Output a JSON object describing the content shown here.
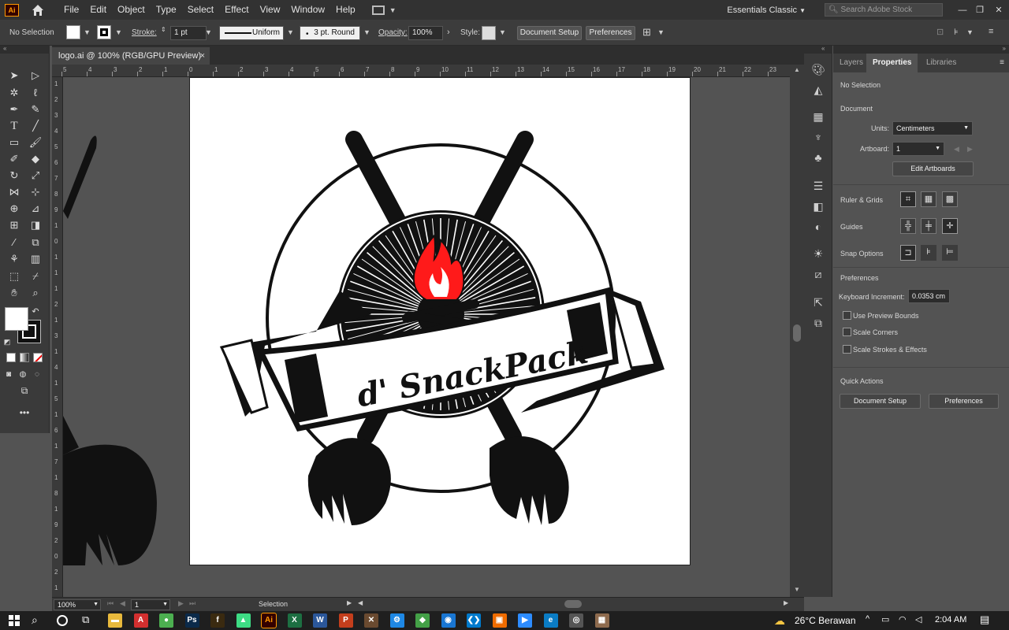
{
  "app": {
    "logo_text": "Ai",
    "brand_color": "#ff9a00",
    "menus": [
      "File",
      "Edit",
      "Object",
      "Type",
      "Select",
      "Effect",
      "View",
      "Window",
      "Help"
    ],
    "workspace": "Essentials Classic",
    "search_placeholder": "Search Adobe Stock"
  },
  "control_bar": {
    "selection": "No Selection",
    "stroke_label": "Stroke:",
    "stroke_weight": "1 pt",
    "profile": "Uniform",
    "brush": "3 pt. Round",
    "opacity_label": "Opacity:",
    "opacity": "100%",
    "style_label": "Style:",
    "doc_setup": "Document Setup",
    "preferences": "Preferences"
  },
  "document": {
    "tab_title": "logo.ai @ 100% (RGB/GPU Preview)",
    "close": "×",
    "logo_text": "d' SnackPack",
    "flame_color": "#ff1a1a"
  },
  "rulers": {
    "top": [
      "5",
      "4",
      "3",
      "2",
      "1",
      "0",
      "1",
      "2",
      "3",
      "4",
      "5",
      "6",
      "7",
      "8",
      "9",
      "10",
      "11",
      "12",
      "13",
      "14",
      "15",
      "16",
      "17",
      "18",
      "19",
      "20",
      "21",
      "22",
      "23"
    ],
    "left": [
      "1",
      "2",
      "3",
      "4",
      "5",
      "6",
      "7",
      "8",
      "9",
      "1",
      "0",
      "1",
      "1",
      "1",
      "2",
      "1",
      "3",
      "1",
      "4",
      "1",
      "5",
      "1",
      "6",
      "1",
      "7",
      "1",
      "8",
      "1",
      "9",
      "2",
      "0",
      "2",
      "1"
    ]
  },
  "status": {
    "zoom": "100%",
    "artboard": "1",
    "tool": "Selection"
  },
  "properties": {
    "tabs": [
      "Layers",
      "Properties",
      "Libraries"
    ],
    "active_tab": "Properties",
    "selection": "No Selection",
    "document_heading": "Document",
    "units_label": "Units:",
    "units_value": "Centimeters",
    "artboard_label": "Artboard:",
    "artboard_value": "1",
    "edit_artboards": "Edit Artboards",
    "ruler_grids": "Ruler & Grids",
    "guides": "Guides",
    "snap_options": "Snap Options",
    "preferences_heading": "Preferences",
    "keyboard_increment_label": "Keyboard Increment:",
    "keyboard_increment": "0.0353 cm",
    "checkboxes": [
      "Use Preview Bounds",
      "Scale Corners",
      "Scale Strokes & Effects"
    ],
    "quick_actions": "Quick Actions",
    "doc_setup_btn": "Document Setup",
    "preferences_btn": "Preferences"
  },
  "taskbar": {
    "weather": "26°C  Berawan",
    "time": "2:04 AM",
    "apps": [
      {
        "name": "file-explorer",
        "label": "▬",
        "color": "#e8b93c"
      },
      {
        "name": "acrobat",
        "label": "A",
        "color": "#d32f2f"
      },
      {
        "name": "chrome",
        "label": "●",
        "color": "#4caf50"
      },
      {
        "name": "photoshop",
        "label": "Ps",
        "color": "#0b2a4a"
      },
      {
        "name": "app-flame",
        "label": "f",
        "color": "#3a2a10"
      },
      {
        "name": "android-studio",
        "label": "▲",
        "color": "#3ddc84"
      },
      {
        "name": "illustrator",
        "label": "Ai",
        "color": "#330000"
      },
      {
        "name": "excel",
        "label": "X",
        "color": "#1d6f42"
      },
      {
        "name": "word",
        "label": "W",
        "color": "#2b579a"
      },
      {
        "name": "powerpoint",
        "label": "P",
        "color": "#c43e1c"
      },
      {
        "name": "app-paint",
        "label": "✕",
        "color": "#6a4a30"
      },
      {
        "name": "app-tool",
        "label": "⚙",
        "color": "#1e88e5"
      },
      {
        "name": "app-green",
        "label": "◆",
        "color": "#43a047"
      },
      {
        "name": "app-chat",
        "label": "◉",
        "color": "#1976d2"
      },
      {
        "name": "vscode",
        "label": "❮❯",
        "color": "#007acc"
      },
      {
        "name": "app-orange",
        "label": "▣",
        "color": "#ef6c00"
      },
      {
        "name": "zoom",
        "label": "▶",
        "color": "#2d8cff"
      },
      {
        "name": "edge",
        "label": "e",
        "color": "#0a7cc4"
      },
      {
        "name": "app-circle",
        "label": "◎",
        "color": "#555555"
      },
      {
        "name": "app-photo",
        "label": "▦",
        "color": "#8e6b4e"
      }
    ]
  }
}
